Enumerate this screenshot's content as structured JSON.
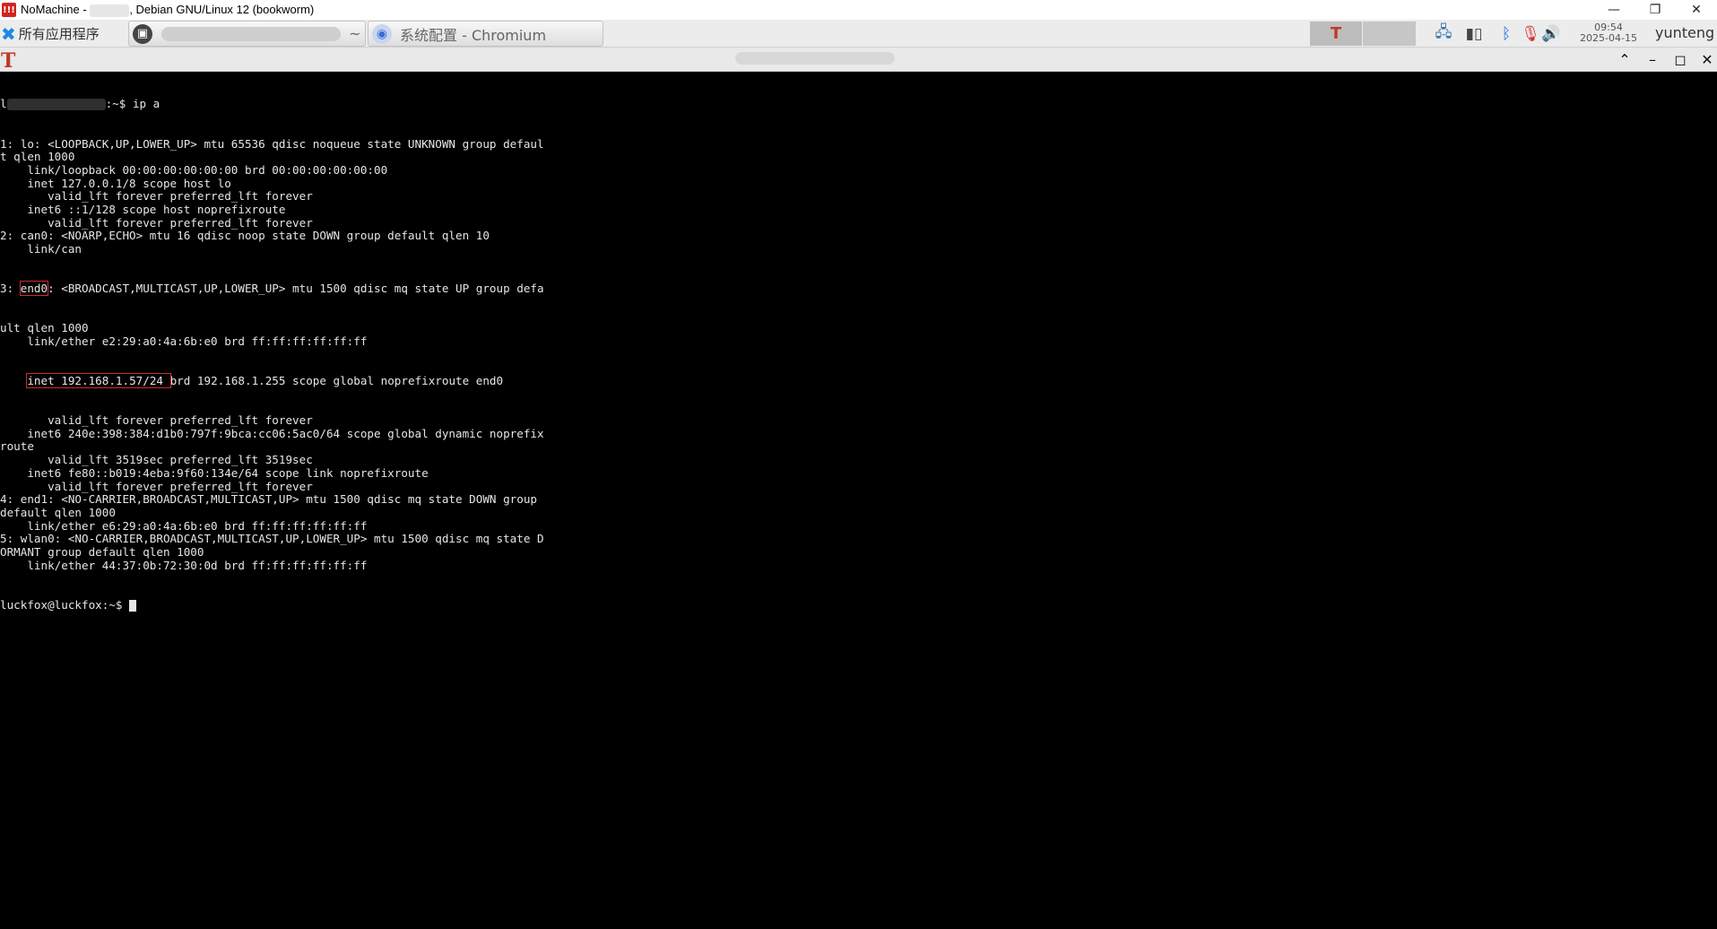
{
  "window": {
    "title_prefix": "NoMachine - ",
    "title_suffix": ", Debian GNU/Linux 12 (bookworm)",
    "minimize": "—",
    "restore": "❐",
    "close": "✕"
  },
  "panel": {
    "menu_label": "所有应用程序",
    "task1_suffix": "~",
    "task2_label": "系统配置 - Chromium",
    "clock_time": "09:54",
    "clock_date": "2025-04-15",
    "user": "yunteng"
  },
  "terminal": {
    "prompt_tail": ":~$ ",
    "command": "ip a",
    "lines": [
      "1: lo: <LOOPBACK,UP,LOWER_UP> mtu 65536 qdisc noqueue state UNKNOWN group defaul",
      "t qlen 1000",
      "    link/loopback 00:00:00:00:00:00 brd 00:00:00:00:00:00",
      "    inet 127.0.0.1/8 scope host lo",
      "       valid_lft forever preferred_lft forever",
      "    inet6 ::1/128 scope host noprefixroute",
      "       valid_lft forever preferred_lft forever",
      "2: can0: <NOARP,ECHO> mtu 16 qdisc noop state DOWN group default qlen 10",
      "    link/can"
    ],
    "line_end0_prefix": "3: ",
    "line_end0_name": "end0",
    "line_end0_rest": ": <BROADCAST,MULTICAST,UP,LOWER_UP> mtu 1500 qdisc mq state UP group defa",
    "lines2": [
      "ult qlen 1000",
      "    link/ether e2:29:a0:4a:6b:e0 brd ff:ff:ff:ff:ff:ff"
    ],
    "inet_indent": "    ",
    "inet_highlight": "inet 192.168.1.57/24 ",
    "inet_rest": "brd 192.168.1.255 scope global noprefixroute end0",
    "lines3": [
      "       valid_lft forever preferred_lft forever",
      "    inet6 240e:398:384:d1b0:797f:9bca:cc06:5ac0/64 scope global dynamic noprefix",
      "route",
      "       valid_lft 3519sec preferred_lft 3519sec",
      "    inet6 fe80::b019:4eba:9f60:134e/64 scope link noprefixroute",
      "       valid_lft forever preferred_lft forever",
      "4: end1: <NO-CARRIER,BROADCAST,MULTICAST,UP> mtu 1500 qdisc mq state DOWN group",
      "default qlen 1000",
      "    link/ether e6:29:a0:4a:6b:e0 brd ff:ff:ff:ff:ff:ff",
      "5: wlan0: <NO-CARRIER,BROADCAST,MULTICAST,UP,LOWER_UP> mtu 1500 qdisc mq state D",
      "ORMANT group default qlen 1000",
      "    link/ether 44:37:0b:72:30:0d brd ff:ff:ff:ff:ff:ff"
    ],
    "final_prompt": "luckfox@luckfox:~$ "
  }
}
